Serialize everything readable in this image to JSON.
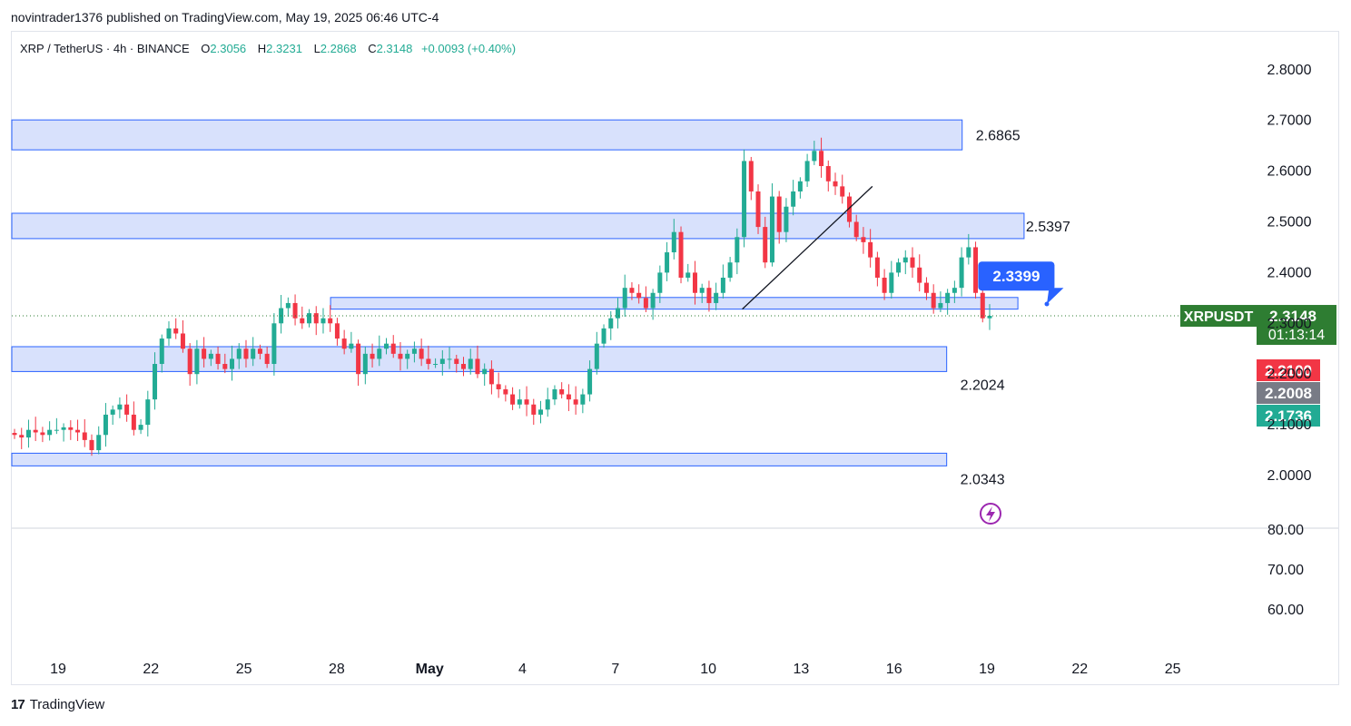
{
  "publisher_line": "novintrader1376 published on TradingView.com, May 19, 2025 06:46 UTC-4",
  "symbol": {
    "name": "XRP / TetherUS · 4h · BINANCE",
    "open_label": "O",
    "open": "2.3056",
    "high_label": "H",
    "high": "2.3231",
    "low_label": "L",
    "low": "2.2868",
    "close_label": "C",
    "close": "2.3148",
    "change": "+0.0093 (+0.40%)"
  },
  "footer": {
    "brand": "TradingView",
    "logo_text": "17"
  },
  "colors": {
    "up": "#22ab94",
    "down": "#f23645",
    "zone_fill": "#d1dcfb",
    "zone_border": "#2962ff",
    "price_tag": "#2e7d32",
    "callout": "#2962ff"
  },
  "chart_data": {
    "type": "candlestick",
    "price_axis": {
      "ticks": [
        "2.8000",
        "2.7000",
        "2.6000",
        "2.5000",
        "2.4000",
        "2.3000",
        "2.2000",
        "2.1000",
        "2.0000"
      ],
      "range": [
        1.9,
        2.83
      ]
    },
    "oscillator_axis": {
      "ticks": [
        "80.00",
        "70.00",
        "60.00"
      ]
    },
    "x_ticks": [
      {
        "label": "19",
        "day": 0
      },
      {
        "label": "22",
        "day": 3
      },
      {
        "label": "25",
        "day": 6
      },
      {
        "label": "28",
        "day": 9
      },
      {
        "label": "May",
        "day": 12
      },
      {
        "label": "4",
        "day": 15
      },
      {
        "label": "7",
        "day": 18
      },
      {
        "label": "10",
        "day": 21
      },
      {
        "label": "13",
        "day": 24
      },
      {
        "label": "16",
        "day": 27
      },
      {
        "label": "19",
        "day": 30
      },
      {
        "label": "22",
        "day": 33
      },
      {
        "label": "25",
        "day": 36
      }
    ],
    "zones": [
      {
        "label": "2.6865",
        "top": 2.701,
        "bottom": 2.642,
        "start_day": -1.5,
        "end_day": 29.2
      },
      {
        "label": "2.5397",
        "top": 2.517,
        "bottom": 2.467,
        "start_day": -1.5,
        "end_day": 31.2
      },
      {
        "label": "",
        "top": 2.351,
        "bottom": 2.328,
        "start_day": 8.8,
        "end_day": 31.0
      },
      {
        "label": "2.2024",
        "top": 2.254,
        "bottom": 2.205,
        "start_day": -1.5,
        "end_day": 28.7
      },
      {
        "label": "2.0343",
        "top": 2.044,
        "bottom": 2.019,
        "start_day": -1.5,
        "end_day": 28.7
      }
    ],
    "trendline": {
      "from": {
        "day": 22.1,
        "price": 2.328
      },
      "to": {
        "day": 26.3,
        "price": 2.57
      }
    },
    "callout": {
      "label": "2.3399",
      "day": 32.3,
      "price": 2.395
    },
    "price_tags": [
      {
        "label": "XRPUSDT",
        "value": "2.3148",
        "countdown": "01:13:14",
        "price": 2.3148
      },
      {
        "label": "",
        "value": "2.2100",
        "price": 2.21
      },
      {
        "label": "",
        "value": "2.2008",
        "price": 2.2008
      },
      {
        "label": "",
        "value": "2.1736",
        "price": 2.1736
      }
    ],
    "candles_close": [
      2.08,
      2.075,
      2.09,
      2.085,
      2.08,
      2.09,
      2.09,
      2.095,
      2.09,
      2.085,
      2.07,
      2.05,
      2.08,
      2.12,
      2.13,
      2.14,
      2.12,
      2.09,
      2.1,
      2.15,
      2.22,
      2.27,
      2.29,
      2.28,
      2.25,
      2.2,
      2.25,
      2.23,
      2.24,
      2.22,
      2.21,
      2.23,
      2.25,
      2.23,
      2.25,
      2.24,
      2.22,
      2.3,
      2.33,
      2.34,
      2.31,
      2.3,
      2.32,
      2.3,
      2.31,
      2.3,
      2.27,
      2.25,
      2.26,
      2.2,
      2.24,
      2.23,
      2.25,
      2.26,
      2.24,
      2.23,
      2.24,
      2.25,
      2.23,
      2.22,
      2.22,
      2.23,
      2.23,
      2.22,
      2.21,
      2.23,
      2.2,
      2.21,
      2.18,
      2.17,
      2.16,
      2.14,
      2.15,
      2.14,
      2.12,
      2.13,
      2.15,
      2.17,
      2.16,
      2.15,
      2.14,
      2.16,
      2.21,
      2.26,
      2.29,
      2.31,
      2.33,
      2.37,
      2.36,
      2.35,
      2.33,
      2.36,
      2.4,
      2.44,
      2.48,
      2.39,
      2.4,
      2.36,
      2.37,
      2.34,
      2.36,
      2.39,
      2.42,
      2.47,
      2.62,
      2.56,
      2.49,
      2.42,
      2.55,
      2.48,
      2.53,
      2.56,
      2.58,
      2.62,
      2.64,
      2.61,
      2.58,
      2.57,
      2.55,
      2.5,
      2.47,
      2.46,
      2.43,
      2.39,
      2.36,
      2.4,
      2.42,
      2.43,
      2.41,
      2.38,
      2.36,
      2.33,
      2.34,
      2.36,
      2.37,
      2.43,
      2.45,
      2.36,
      2.31,
      2.3148
    ]
  }
}
